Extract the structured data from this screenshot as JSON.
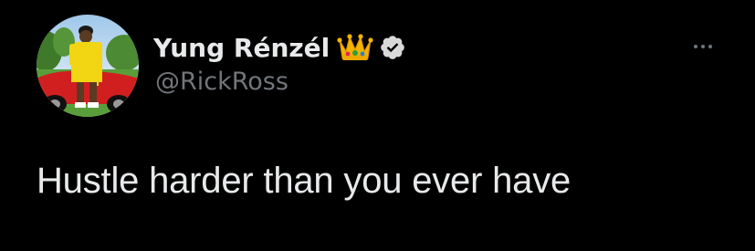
{
  "tweet": {
    "author": {
      "display_name": "Yung Rénzél",
      "handle": "@RickRoss",
      "name_emoji": "crown-emoji",
      "verified_icon": "verified-badge-icon"
    },
    "more_icon": "more-options-icon",
    "text": "Hustle harder than you ever have"
  },
  "colors": {
    "background": "#000000",
    "primary_text": "#e7e9ea",
    "secondary_text": "#71767b"
  }
}
